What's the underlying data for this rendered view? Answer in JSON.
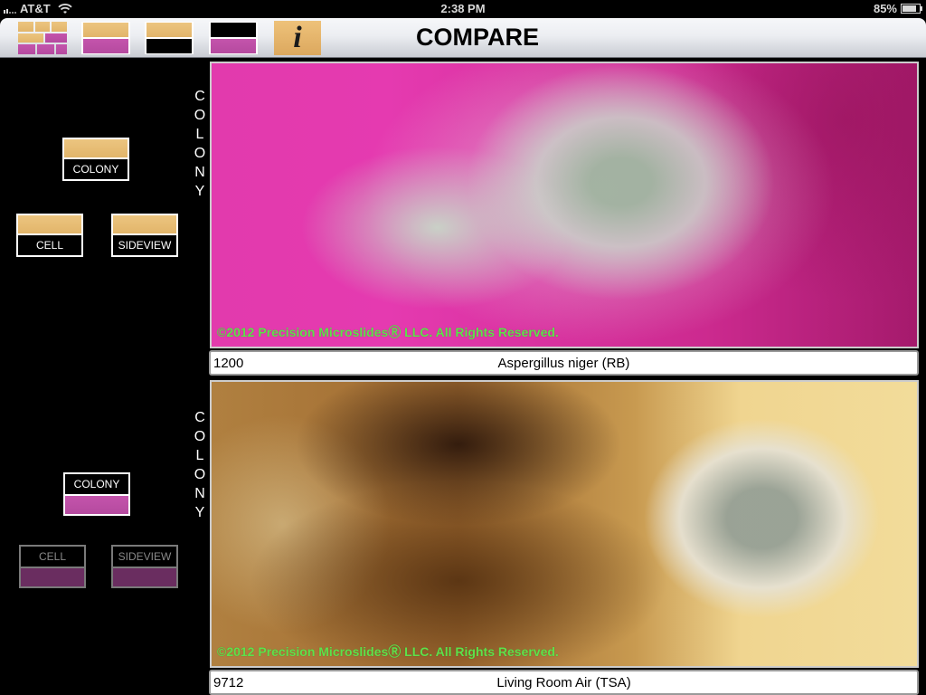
{
  "status_bar": {
    "carrier": "AT&T",
    "time": "2:38 PM",
    "battery_percent_label": "85%",
    "battery_level": 0.85,
    "icons": [
      "signal-icon",
      "wifi-icon",
      "battery-icon"
    ]
  },
  "toolbar": {
    "title": "COMPARE",
    "buttons": [
      {
        "name": "grid-view",
        "icon": "grid-tiles-icon"
      },
      {
        "name": "tan-over-pink",
        "icon": "split-tan-pink-icon"
      },
      {
        "name": "tan-over-black",
        "icon": "split-tan-black-icon"
      },
      {
        "name": "black-over-pink",
        "icon": "split-black-pink-icon"
      },
      {
        "name": "info",
        "icon": "info-icon",
        "label": "i"
      }
    ]
  },
  "colors": {
    "tan": "#E6B96E",
    "pink": "#BE50A6",
    "copyright_green": "#5EE14A"
  },
  "top_panel": {
    "vertical_label": [
      "C",
      "O",
      "L",
      "O",
      "N",
      "Y"
    ],
    "controls": {
      "colony": "COLONY",
      "cell": "CELL",
      "sideview": "SIDEVIEW"
    },
    "copyright": "©2012 Precision MicroslidesⓇ LLC.  All Rights Reserved.",
    "caption_number": "1200",
    "caption_name": "Aspergillus niger (RB)"
  },
  "bottom_panel": {
    "vertical_label": [
      "C",
      "O",
      "L",
      "O",
      "N",
      "Y"
    ],
    "controls": {
      "colony": "COLONY",
      "cell": "CELL",
      "sideview": "SIDEVIEW"
    },
    "copyright": "©2012 Precision MicroslidesⓇ LLC.  All Rights Reserved.",
    "caption_number": "9712",
    "caption_name": "Living Room Air (TSA)"
  }
}
